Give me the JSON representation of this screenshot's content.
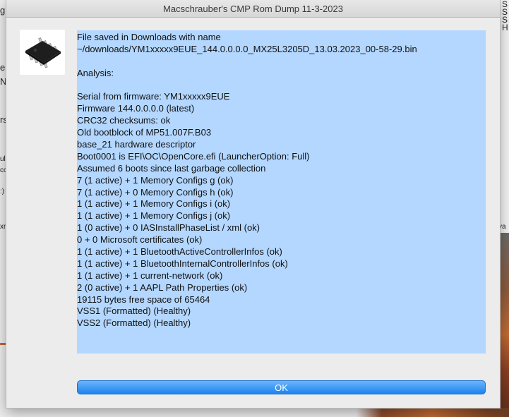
{
  "dialog": {
    "title": "Macschrauber's CMP Rom Dump 11-3-2023",
    "icon": "chip-icon",
    "ok_label": "OK"
  },
  "report": {
    "lines": [
      "File saved in Downloads with name",
      "~/downloads/YM1xxxxx9EUE_144.0.0.0.0_MX25L3205D_13.03.2023_00-58-29.bin",
      "",
      "Analysis:",
      "",
      "Serial from firmware: YM1xxxxx9EUE",
      "Firmware 144.0.0.0.0 (latest)",
      "CRC32 checksums: ok",
      "Old bootblock of MP51.007F.B03",
      "base_21 hardware descriptor",
      "Boot0001 is EFI\\OC\\OpenCore.efi (LauncherOption: Full)",
      "Assumed 6 boots since last garbage collection",
      "7 (1 active) + 1 Memory Configs g (ok)",
      "7 (1 active) + 0 Memory Configs h (ok)",
      "1 (1 active) + 1 Memory Configs i (ok)",
      "1 (1 active) + 1 Memory Configs j (ok)",
      "1 (0 active) + 0 IASInstallPhaseList / xml (ok)",
      "0 + 0 Microsoft certificates (ok)",
      "1 (1 active) + 1 BluetoothActiveControllerInfos (ok)",
      "1 (1 active) + 1 BluetoothInternalControllerInfos (ok)",
      "1 (1 active) + 1 current-network (ok)",
      "2 (0 active) + 1 AAPL Path Properties (ok)",
      "19115 bytes free space of 65464",
      "VSS1 (Formatted) (Healthy)",
      "VSS2 (Formatted) (Healthy)"
    ]
  },
  "background": {
    "left_fragments": [
      "g",
      "ep",
      "N",
      "rs",
      "ul",
      "co",
      ":)",
      "xn"
    ],
    "right_fragments": [
      "S",
      "S",
      "S",
      "H",
      "va"
    ]
  },
  "colors": {
    "selection": "#b3d7ff",
    "accent": "#1c84f0"
  }
}
